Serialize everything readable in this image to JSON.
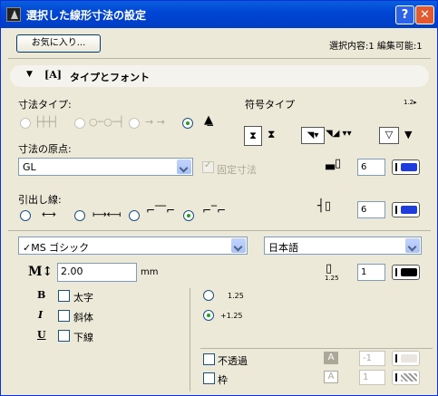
{
  "window": {
    "title": "選択した線形寸法の設定",
    "help": "?",
    "close": "✕"
  },
  "header": {
    "favorites_button": "お気に入り...",
    "selection_info": "選択内容:1 編集可能:1"
  },
  "section": {
    "title": "タイプとフォント"
  },
  "dimension_type": {
    "label": "寸法タイプ:",
    "symbol_type_label": "符号タイプ"
  },
  "origin": {
    "label": "寸法の原点:",
    "value": "GL",
    "fixed_label": "固定寸法",
    "pen_value": "6"
  },
  "leader": {
    "label": "引出し線:",
    "pen_value": "6"
  },
  "font": {
    "family": "✓MS ゴシック",
    "language": "日本語",
    "pen_value": "1"
  },
  "text_size": {
    "value": "2.00",
    "unit": "mm"
  },
  "style": {
    "bold": "太字",
    "italic": "斜体",
    "underline": "下線",
    "bold_icon": "B",
    "italic_icon": "I",
    "underline_icon": "U"
  },
  "spacing": {
    "opt1": "1.25",
    "opt2": "+1.25",
    "small_label": "1.25"
  },
  "fill": {
    "opaque_label": "不透過",
    "frame_label": "枠",
    "bg_pen": "-1",
    "frame_pen": "1"
  },
  "colors": {
    "pen_blue": "#1f3ddb",
    "pen_black": "#000000",
    "accent": "#0046d5"
  }
}
